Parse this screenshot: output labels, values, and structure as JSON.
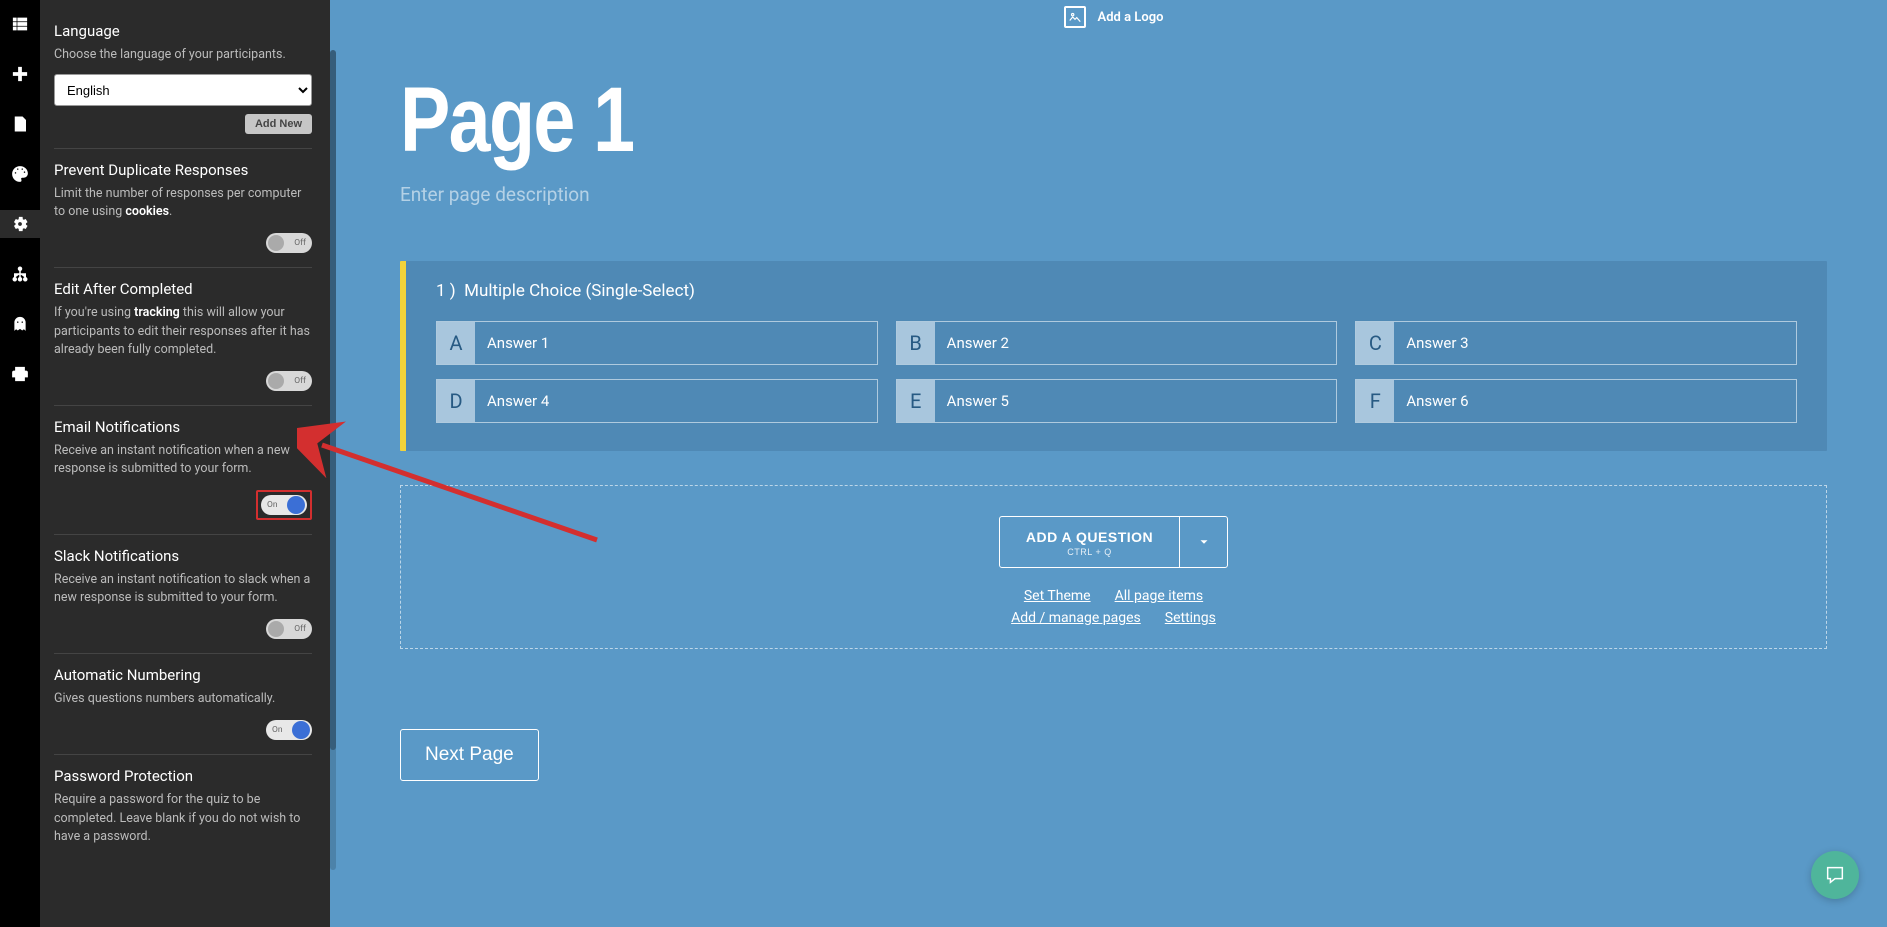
{
  "rail": {
    "items": [
      "list",
      "add",
      "page",
      "theme",
      "settings",
      "tree",
      "preview",
      "print"
    ]
  },
  "settings": {
    "language": {
      "title": "Language",
      "desc": "Choose the language of your participants.",
      "value": "English",
      "add_new": "Add New"
    },
    "prevent_dup": {
      "title": "Prevent Duplicate Responses",
      "desc_pre": "Limit the number of responses per computer to one using ",
      "desc_bold": "cookies",
      "desc_post": ".",
      "state": "Off"
    },
    "edit_after": {
      "title": "Edit After Completed",
      "desc_pre": "If you're using ",
      "desc_bold": "tracking",
      "desc_post": " this will allow your participants to edit their responses after it has already been fully completed.",
      "state": "Off"
    },
    "email_notif": {
      "title": "Email Notifications",
      "desc": "Receive an instant notification when a new response is submitted to your form.",
      "state": "On"
    },
    "slack_notif": {
      "title": "Slack Notifications",
      "desc": "Receive an instant notification to slack when a new response is submitted to your form.",
      "state": "Off"
    },
    "auto_num": {
      "title": "Automatic Numbering",
      "desc": "Gives questions numbers automatically.",
      "state": "On"
    },
    "password": {
      "title": "Password Protection",
      "desc": "Require a password for the quiz to be completed. Leave blank if you do not wish to have a password."
    }
  },
  "canvas": {
    "add_logo": "Add a Logo",
    "page_title": "Page 1",
    "page_desc_placeholder": "Enter page description",
    "question": {
      "number": "1 )",
      "type": "Multiple Choice (Single-Select)",
      "answers": [
        {
          "letter": "A",
          "label": "Answer 1"
        },
        {
          "letter": "B",
          "label": "Answer 2"
        },
        {
          "letter": "C",
          "label": "Answer 3"
        },
        {
          "letter": "D",
          "label": "Answer 4"
        },
        {
          "letter": "E",
          "label": "Answer 5"
        },
        {
          "letter": "F",
          "label": "Answer 6"
        }
      ]
    },
    "add_q": {
      "label": "ADD A QUESTION",
      "shortcut": "CTRL + Q"
    },
    "links": {
      "set_theme": "Set Theme",
      "all_items": "All page items",
      "manage_pages": "Add / manage pages",
      "settings": "Settings"
    },
    "next_page": "Next Page"
  }
}
